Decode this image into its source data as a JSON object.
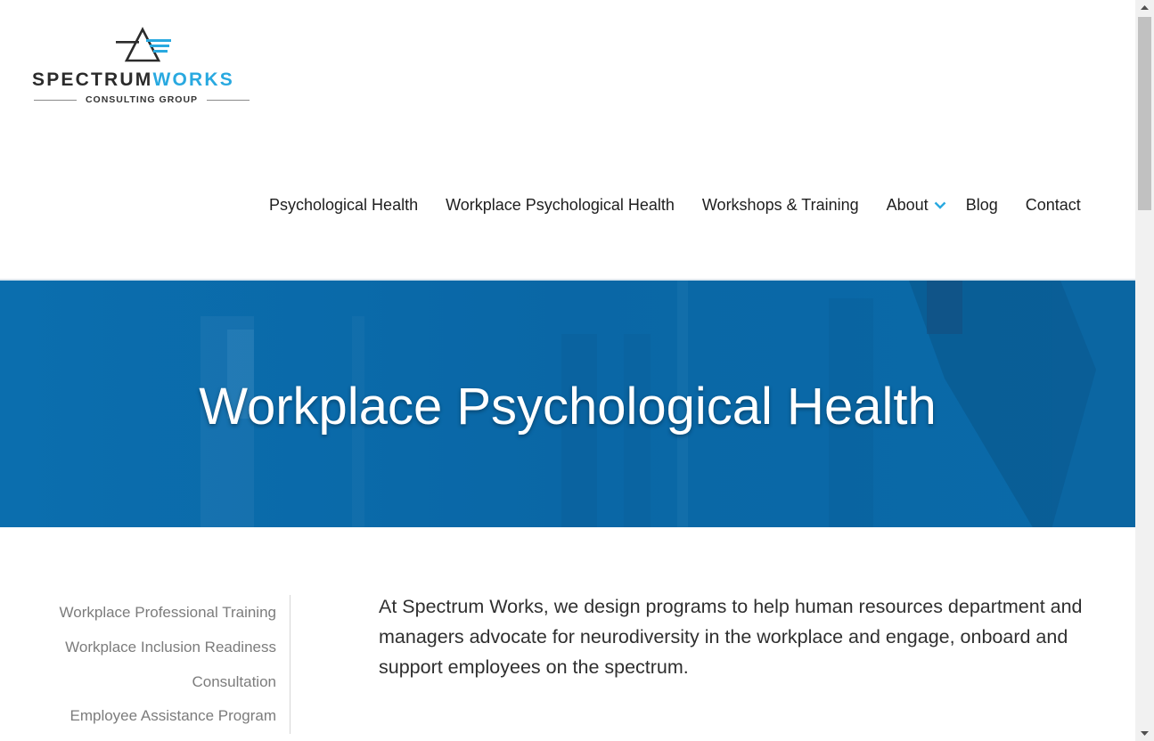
{
  "logo": {
    "word_dark": "SPECTRUM",
    "word_blue_1": "W",
    "word_gear": "O",
    "word_blue_2": "RKS",
    "subtitle": "CONSULTING GROUP"
  },
  "nav": {
    "items": [
      {
        "label": "Psychological Health"
      },
      {
        "label": "Workplace Psychological Health"
      },
      {
        "label": "Workshops & Training"
      },
      {
        "label": "About"
      },
      {
        "label": "Blog"
      },
      {
        "label": "Contact"
      }
    ]
  },
  "hero": {
    "title": "Workplace Psychological Health"
  },
  "sidebar": {
    "links": [
      {
        "label": "Workplace Professional Training"
      },
      {
        "label": "Workplace Inclusion Readiness"
      },
      {
        "label": "Consultation"
      },
      {
        "label": "Employee Assistance Program"
      }
    ]
  },
  "main": {
    "intro": "At Spectrum Works, we design programs to help human resources department and managers advocate for neurodiversity in the workplace and engage, onboard and support employees on the spectrum."
  },
  "colors": {
    "brand_blue": "#29a9e0",
    "hero_blue": "#0a6aa8",
    "text_dark": "#1e1e1e",
    "sidebar_text": "#7c7c7c"
  },
  "icons": {
    "about_dropdown": "chevron-down-icon",
    "logo_mark": "triangle-speed-icon",
    "scroll_up": "arrow-up-icon",
    "scroll_down": "arrow-down-icon"
  }
}
